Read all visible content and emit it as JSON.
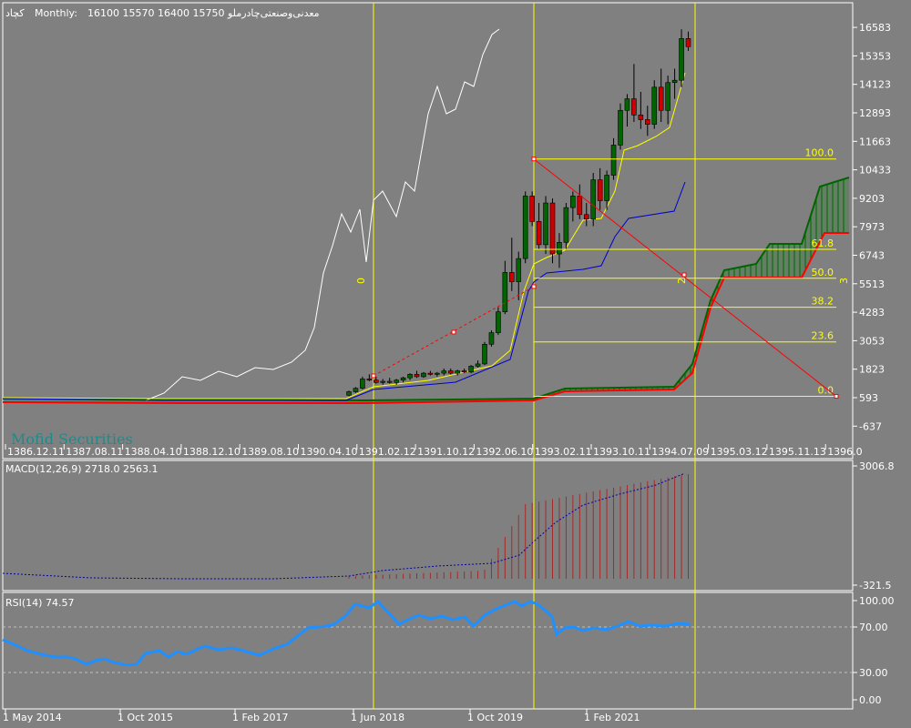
{
  "header": {
    "symbol": "کچاد",
    "period": "Monthly:",
    "ohlc": "16100 15570 16400 15750",
    "company": "معدنی‌وصنعتی‌چادرملو"
  },
  "watermark": "Mofid Securities",
  "colors": {
    "background": "#808080",
    "bull": "#006400",
    "bear": "#cc0000",
    "tenkan": "#ffff00",
    "kijun": "#0000cc",
    "chikou": "#ffffff",
    "fib": "#ffff00",
    "macd_hist": "#a52a2a",
    "macd_signal": "#0000aa",
    "rsi": "#1e90ff"
  },
  "main": {
    "price_ticks": [
      "16583",
      "15353",
      "14123",
      "12893",
      "11663",
      "10433",
      "9203",
      "7973",
      "6743",
      "5513",
      "4283",
      "3053",
      "1823",
      "593",
      "-637"
    ],
    "time_ticks": [
      "1386.12.11",
      "1387.08.11",
      "1388.04.10",
      "1388.12.10",
      "1389.08.10",
      "1390.04.10",
      "1391.02.12",
      "1391.10.12",
      "1392.06.10",
      "1393.02.11",
      "1393.10.11",
      "1394.07.09",
      "1395.03.12",
      "1395.11.13",
      "1396.0"
    ],
    "fib_levels": [
      "100.0",
      "61.8",
      "50.0",
      "38.2",
      "23.6",
      "0.0"
    ],
    "vline_labels": [
      "0",
      "2",
      "3"
    ]
  },
  "macd": {
    "label": "MACD(12,26,9) 2718.0 2563.1",
    "ticks": [
      "3006.8",
      "-321.5"
    ]
  },
  "rsi": {
    "label": "RSI(14) 74.57",
    "ticks": [
      "100.00",
      "70.00",
      "30.00",
      "0.00"
    ]
  },
  "bottom_axis": [
    "1 May 2014",
    "1 Oct 2015",
    "1 Feb 2017",
    "1 Jun 2018",
    "1 Oct 2019",
    "1 Feb 2021"
  ],
  "chart_data": {
    "type": "candlestick",
    "period": "Monthly",
    "indicators": [
      "Ichimoku",
      "Fibonacci retracement",
      "MACD(12,26,9)",
      "RSI(14)"
    ],
    "fib_retracement": [
      {
        "level": "100.0",
        "price": 10900
      },
      {
        "level": "61.8",
        "price": 7000
      },
      {
        "level": "50.0",
        "price": 5750
      },
      {
        "level": "38.2",
        "price": 4500
      },
      {
        "level": "23.6",
        "price": 3000
      },
      {
        "level": "0.0",
        "price": 650
      }
    ],
    "candles": [
      {
        "o": 700,
        "h": 900,
        "l": 650,
        "c": 850
      },
      {
        "o": 850,
        "h": 1050,
        "l": 800,
        "c": 1000
      },
      {
        "o": 1000,
        "h": 1500,
        "l": 950,
        "c": 1400
      },
      {
        "o": 1400,
        "h": 1600,
        "l": 1300,
        "c": 1350
      },
      {
        "o": 1350,
        "h": 1500,
        "l": 1200,
        "c": 1250
      },
      {
        "o": 1250,
        "h": 1400,
        "l": 1150,
        "c": 1300
      },
      {
        "o": 1300,
        "h": 1450,
        "l": 1200,
        "c": 1250
      },
      {
        "o": 1250,
        "h": 1400,
        "l": 1150,
        "c": 1350
      },
      {
        "o": 1350,
        "h": 1500,
        "l": 1250,
        "c": 1450
      },
      {
        "o": 1450,
        "h": 1650,
        "l": 1350,
        "c": 1600
      },
      {
        "o": 1600,
        "h": 1750,
        "l": 1450,
        "c": 1500
      },
      {
        "o": 1500,
        "h": 1700,
        "l": 1450,
        "c": 1650
      },
      {
        "o": 1650,
        "h": 1750,
        "l": 1550,
        "c": 1600
      },
      {
        "o": 1600,
        "h": 1700,
        "l": 1500,
        "c": 1650
      },
      {
        "o": 1650,
        "h": 1850,
        "l": 1550,
        "c": 1750
      },
      {
        "o": 1750,
        "h": 1850,
        "l": 1600,
        "c": 1650
      },
      {
        "o": 1650,
        "h": 1800,
        "l": 1550,
        "c": 1750
      },
      {
        "o": 1750,
        "h": 1850,
        "l": 1650,
        "c": 1700
      },
      {
        "o": 1700,
        "h": 2000,
        "l": 1650,
        "c": 1950
      },
      {
        "o": 1950,
        "h": 2200,
        "l": 1900,
        "c": 2050
      },
      {
        "o": 2050,
        "h": 3000,
        "l": 2000,
        "c": 2900
      },
      {
        "o": 2900,
        "h": 3500,
        "l": 2800,
        "c": 3400
      },
      {
        "o": 3400,
        "h": 4500,
        "l": 3300,
        "c": 4300
      },
      {
        "o": 4300,
        "h": 6500,
        "l": 4200,
        "c": 6000
      },
      {
        "o": 6000,
        "h": 7500,
        "l": 5200,
        "c": 5600
      },
      {
        "o": 5600,
        "h": 6900,
        "l": 4800,
        "c": 6600
      },
      {
        "o": 6600,
        "h": 9500,
        "l": 6400,
        "c": 9300
      },
      {
        "o": 9300,
        "h": 9500,
        "l": 8000,
        "c": 8200
      },
      {
        "o": 8200,
        "h": 9000,
        "l": 7000,
        "c": 7200
      },
      {
        "o": 7200,
        "h": 9300,
        "l": 6800,
        "c": 9000
      },
      {
        "o": 9000,
        "h": 9200,
        "l": 6400,
        "c": 6800
      },
      {
        "o": 6800,
        "h": 7700,
        "l": 6200,
        "c": 7300
      },
      {
        "o": 7300,
        "h": 9000,
        "l": 7000,
        "c": 8800
      },
      {
        "o": 8800,
        "h": 9500,
        "l": 8200,
        "c": 9300
      },
      {
        "o": 9300,
        "h": 9800,
        "l": 8300,
        "c": 8500
      },
      {
        "o": 8500,
        "h": 9000,
        "l": 8000,
        "c": 8300
      },
      {
        "o": 8300,
        "h": 10300,
        "l": 8000,
        "c": 10000
      },
      {
        "o": 10000,
        "h": 10500,
        "l": 8700,
        "c": 9100
      },
      {
        "o": 9100,
        "h": 10400,
        "l": 8700,
        "c": 10200
      },
      {
        "o": 10200,
        "h": 11800,
        "l": 10000,
        "c": 11500
      },
      {
        "o": 11500,
        "h": 13300,
        "l": 11300,
        "c": 13000
      },
      {
        "o": 13000,
        "h": 13700,
        "l": 12300,
        "c": 13500
      },
      {
        "o": 13500,
        "h": 15000,
        "l": 12500,
        "c": 12800
      },
      {
        "o": 12800,
        "h": 13800,
        "l": 12200,
        "c": 12600
      },
      {
        "o": 12600,
        "h": 13200,
        "l": 11900,
        "c": 12400
      },
      {
        "o": 12400,
        "h": 14300,
        "l": 12200,
        "c": 14000
      },
      {
        "o": 14000,
        "h": 14800,
        "l": 12500,
        "c": 13000
      },
      {
        "o": 13000,
        "h": 14500,
        "l": 12400,
        "c": 14200
      },
      {
        "o": 14200,
        "h": 14800,
        "l": 13500,
        "c": 14300
      },
      {
        "o": 14300,
        "h": 16500,
        "l": 14000,
        "c": 16100
      },
      {
        "o": 16100,
        "h": 16400,
        "l": 15570,
        "c": 15750
      }
    ]
  }
}
